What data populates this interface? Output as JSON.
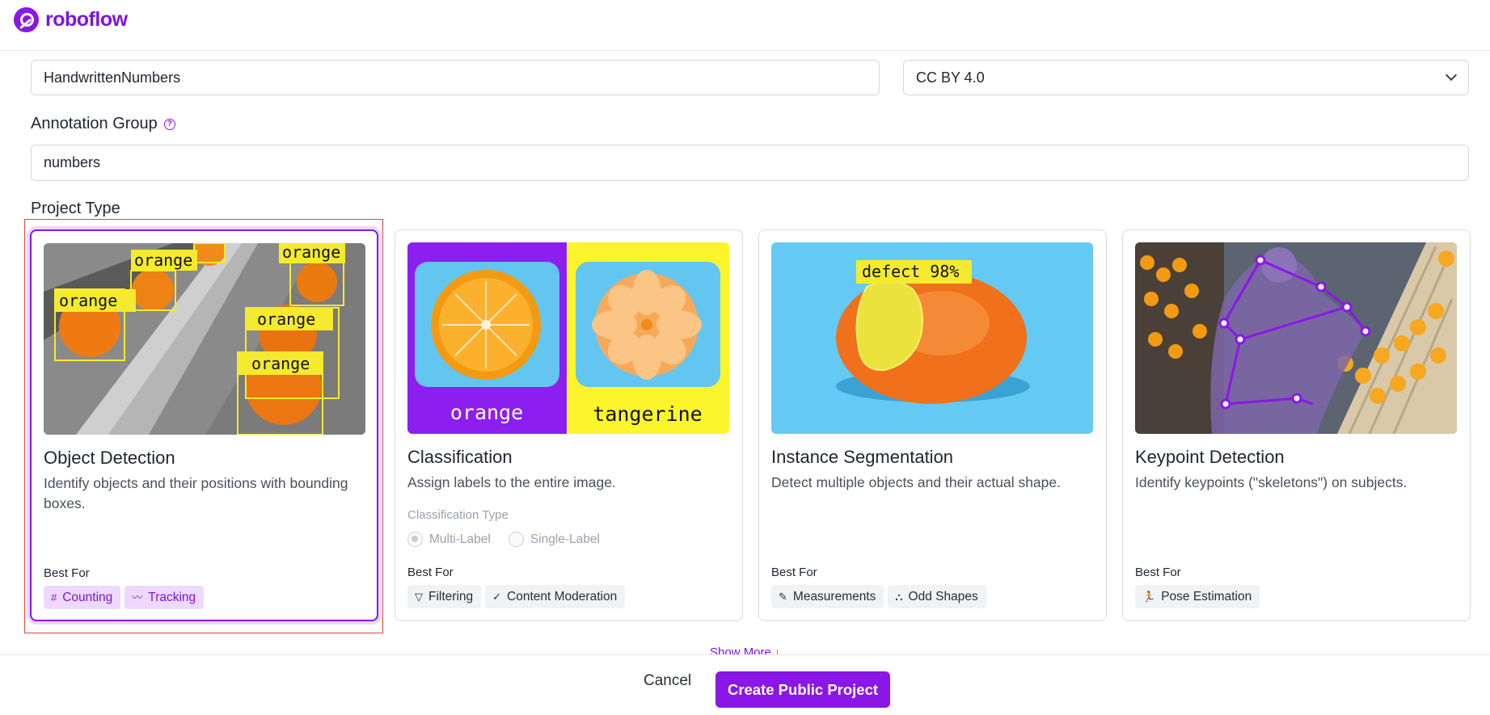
{
  "brand": {
    "name": "roboflow",
    "color": "#8a16e8"
  },
  "form": {
    "project_name": "HandwrittenNumbers",
    "license": "CC BY 4.0",
    "annotation_group_label": "Annotation Group",
    "annotation_group": "numbers",
    "project_type_label": "Project Type"
  },
  "cards": [
    {
      "title": "Object Detection",
      "description": "Identify objects and their positions with bounding boxes.",
      "best_for_label": "Best For",
      "tags": [
        {
          "label": "Counting",
          "icon": "hash-icon"
        },
        {
          "label": "Tracking",
          "icon": "tracking-icon"
        }
      ],
      "image_labels": [
        "orange",
        "orange",
        "orange",
        "orange",
        "orange"
      ],
      "selected": true
    },
    {
      "title": "Classification",
      "description": "Assign labels to the entire image.",
      "classification_type_label": "Classification Type",
      "options": [
        "Multi-Label",
        "Single-Label"
      ],
      "best_for_label": "Best For",
      "tags": [
        {
          "label": "Filtering",
          "icon": "filter-icon"
        },
        {
          "label": "Content Moderation",
          "icon": "check-icon"
        }
      ],
      "image_labels": [
        "orange",
        "tangerine"
      ]
    },
    {
      "title": "Instance Segmentation",
      "description": "Detect multiple objects and their actual shape.",
      "best_for_label": "Best For",
      "tags": [
        {
          "label": "Measurements",
          "icon": "ruler-icon"
        },
        {
          "label": "Odd Shapes",
          "icon": "shapes-icon"
        }
      ],
      "image_labels": [
        "defect 98%"
      ]
    },
    {
      "title": "Keypoint Detection",
      "description": "Identify keypoints (\"skeletons\") on subjects.",
      "best_for_label": "Best For",
      "tags": [
        {
          "label": "Pose Estimation",
          "icon": "person-running-icon"
        }
      ]
    }
  ],
  "show_more": "Show More ↓",
  "footer": {
    "cancel": "Cancel",
    "create": "Create Public Project"
  }
}
